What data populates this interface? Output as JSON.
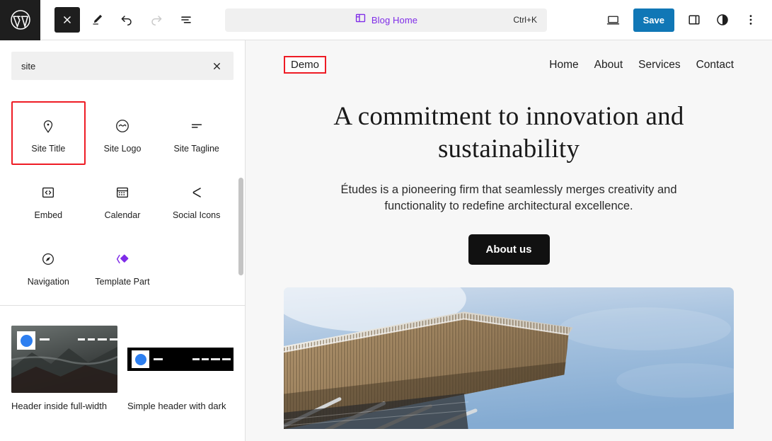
{
  "topbar": {
    "logo_icon": "wordpress-logo-icon",
    "close_icon": "close-icon",
    "edit_icon": "pencil-edit-icon",
    "undo_icon": "undo-arrow-icon",
    "redo_icon": "redo-arrow-icon",
    "listview_icon": "list-view-icon",
    "command_bar": {
      "icon": "template-layout-icon",
      "label": "Blog Home",
      "shortcut": "Ctrl+K",
      "accent_color": "#7f2ce8"
    },
    "view_icon": "desktop-preview-icon",
    "save_label": "Save",
    "save_color": "#1077b6",
    "sidebar_toggle_icon": "settings-sidebar-icon",
    "styles_icon": "styles-contrast-icon",
    "options_icon": "more-options-icon"
  },
  "sidebar": {
    "search": {
      "value": "site",
      "placeholder": "Search",
      "clear_icon": "clear-x-icon"
    },
    "blocks": [
      {
        "label": "Site Title",
        "icon": "map-pin-icon",
        "highlighted": true
      },
      {
        "label": "Site Logo",
        "icon": "site-logo-icon",
        "highlighted": false
      },
      {
        "label": "Site Tagline",
        "icon": "tagline-lines-icon",
        "highlighted": false
      },
      {
        "label": "Embed",
        "icon": "embed-code-icon",
        "highlighted": false
      },
      {
        "label": "Calendar",
        "icon": "calendar-icon",
        "highlighted": false
      },
      {
        "label": "Social Icons",
        "icon": "share-icon",
        "highlighted": false
      },
      {
        "label": "Navigation",
        "icon": "compass-icon",
        "highlighted": false
      },
      {
        "label": "Template Part",
        "icon": "template-part-icon",
        "highlighted": false
      }
    ],
    "highlight_color": "#ee1c25",
    "patterns": [
      {
        "label": "Header inside full-width",
        "style": "dark-photo"
      },
      {
        "label": "Simple header with dark",
        "style": "black-bar"
      }
    ]
  },
  "canvas": {
    "site_title": "Demo",
    "site_title_highlight_color": "#ee1c25",
    "nav": [
      "Home",
      "About",
      "Services",
      "Contact"
    ],
    "hero": {
      "heading": "A commitment to innovation and sustainability",
      "paragraph": "Études is a pioneering firm that seamlessly merges creativity and functionality to redefine architectural excellence.",
      "button_label": "About us"
    },
    "hero_image_alt": "architectural-canopy-photo"
  }
}
